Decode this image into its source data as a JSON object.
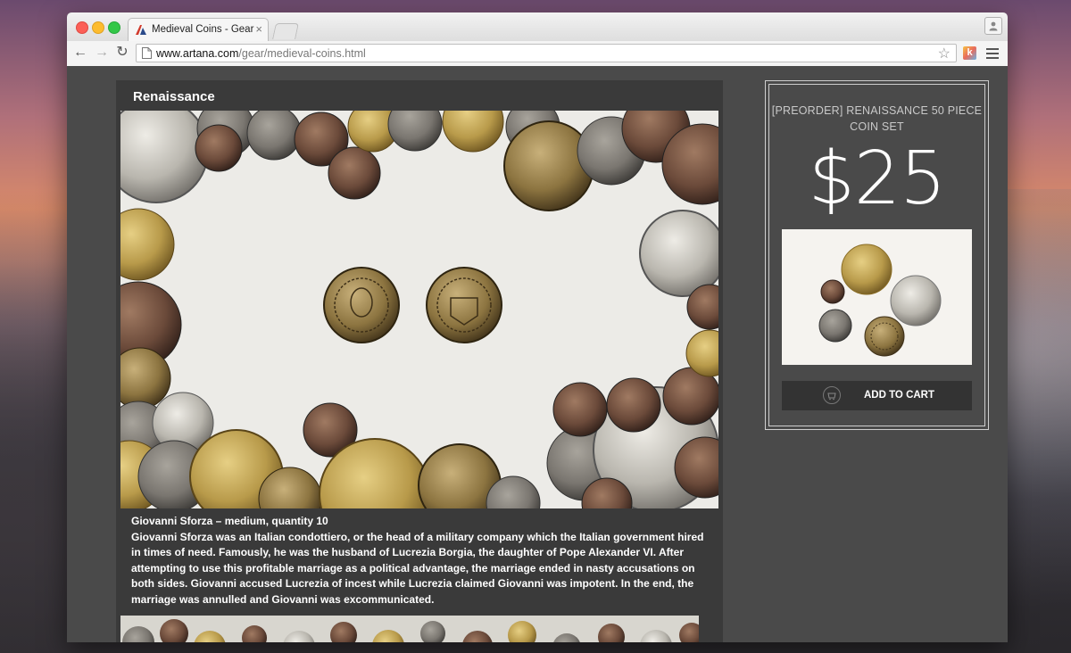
{
  "browser": {
    "tab_title": "Medieval Coins - Gear",
    "tab_close": "×",
    "url_host": "www.artana.com",
    "url_path": "/gear/medieval-coins.html",
    "back": "←",
    "forward": "→",
    "reload": "↻",
    "bookmark": "☆",
    "extension_label": "k"
  },
  "gallery": {
    "title": "Renaissance",
    "caption_title": "Giovanni Sforza – medium, quantity 10",
    "caption_body": "Giovanni Sforza was an Italian condottiero, or the head of a military company which the Italian government hired in times of need. Famously, he was the husband of Lucrezia Borgia, the daughter of Pope Alexander VI. After attempting to use this profitable marriage as a political advantage, the marriage ended in nasty accusations on both sides. Giovanni accused Lucrezia of incest while Lucrezia claimed Giovanni was impotent. In the end, the marriage was annulled and Giovanni was excommunicated."
  },
  "product": {
    "title": "[PREORDER] RENAISSANCE 50 PIECE COIN SET",
    "price": "$25",
    "add_to_cart": "ADD TO CART"
  },
  "colors": {
    "gold": "#b89a4a",
    "bronze": "#6b4a3a",
    "silver": "#b9b6ae",
    "pewter": "#7a7670"
  }
}
